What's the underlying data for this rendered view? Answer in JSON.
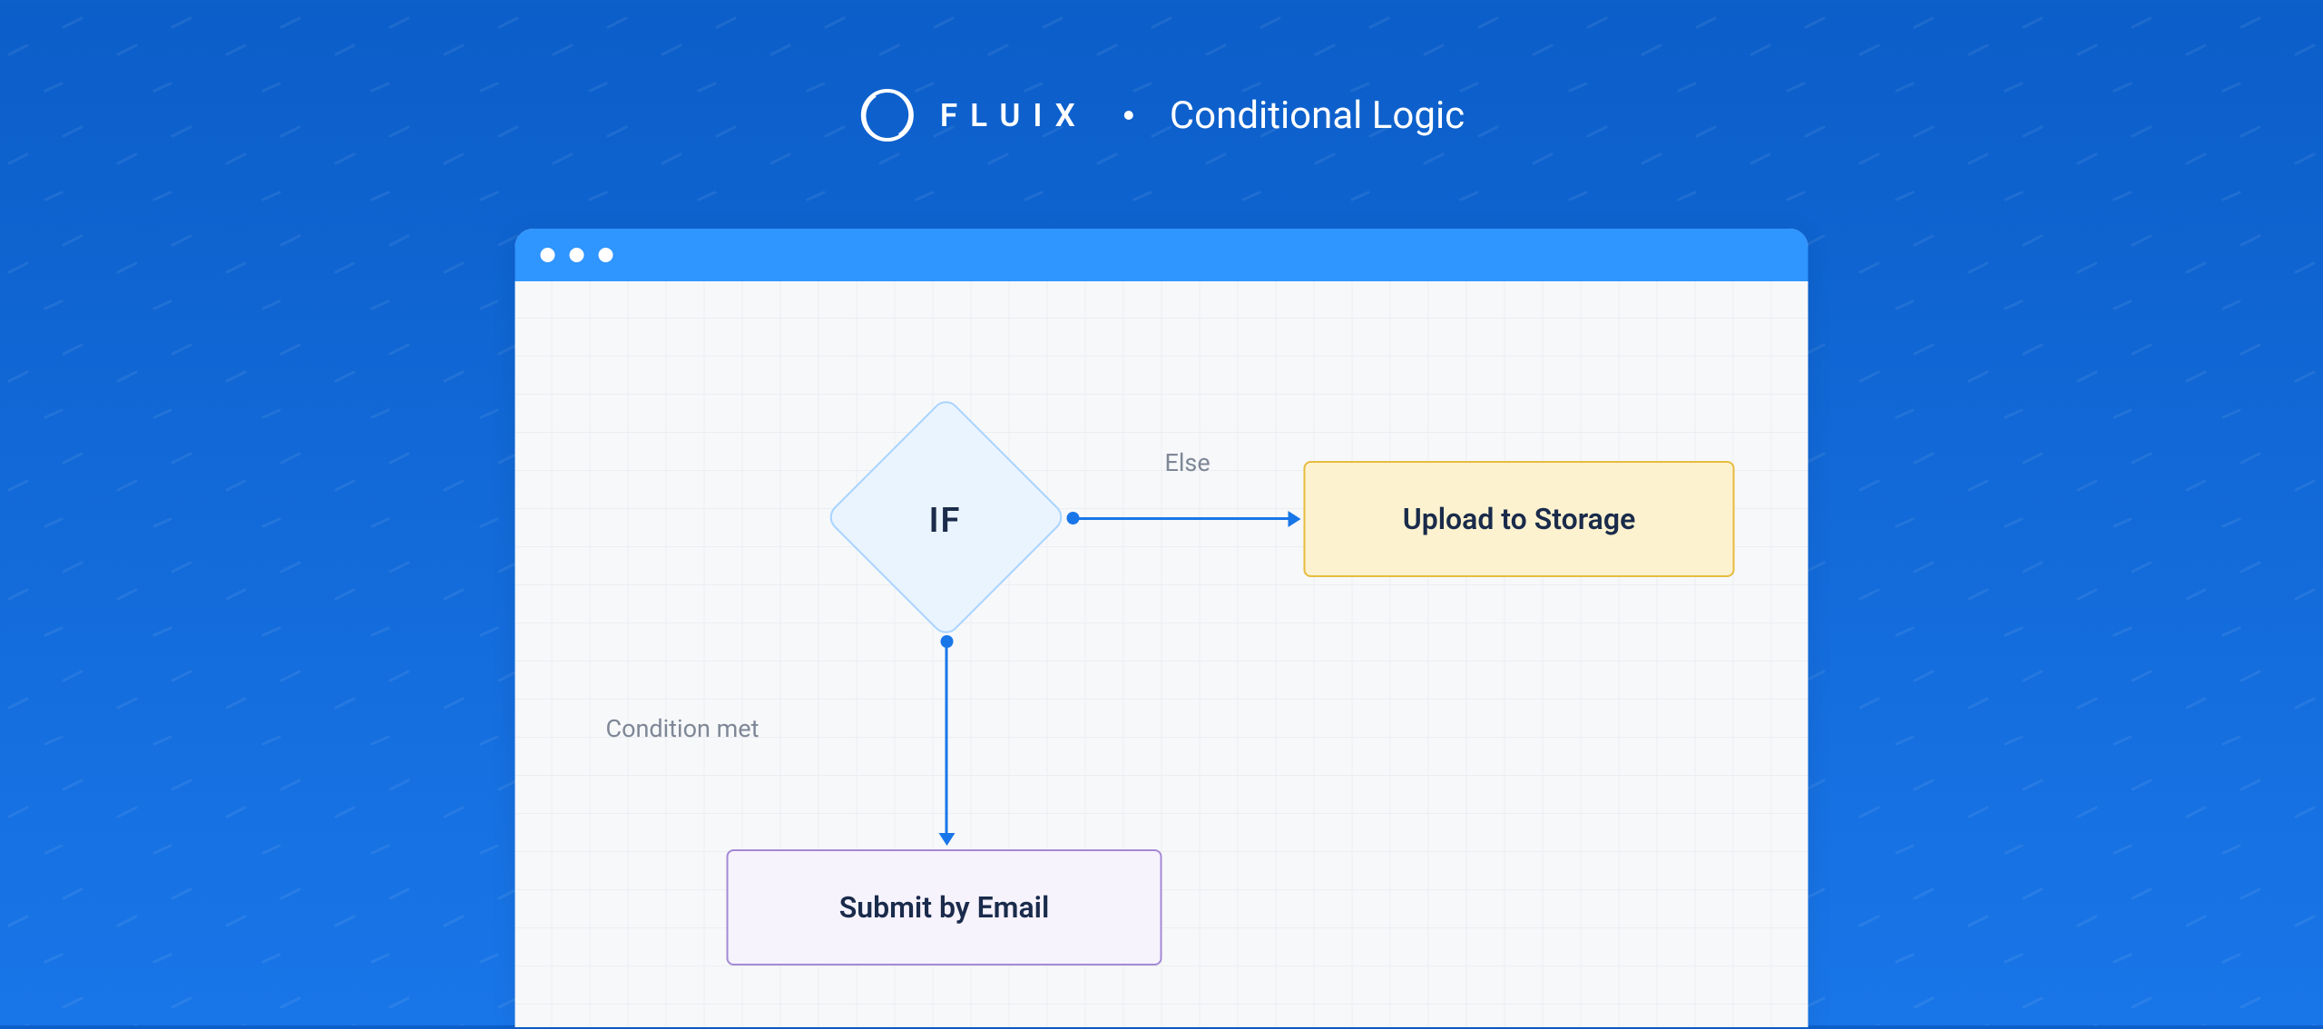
{
  "header": {
    "brand": "FLUIX",
    "title": "Conditional Logic"
  },
  "diagram": {
    "decision": {
      "label": "IF"
    },
    "edges": {
      "else": {
        "label": "Else"
      },
      "condition_met": {
        "label": "Condition met"
      }
    },
    "nodes": {
      "storage": {
        "label": "Upload to Storage"
      },
      "email": {
        "label": "Submit by Email"
      }
    }
  },
  "colors": {
    "bg_top": "#0c5ec9",
    "bg_bottom": "#1976e8",
    "diamond_fill": "#eaf4ff",
    "diamond_border": "#a9d4ff",
    "storage_fill": "#fdf2cf",
    "storage_border": "#e7bb3f",
    "email_fill": "#f6f3fd",
    "email_border": "#a489d5",
    "connector": "#1976e8"
  }
}
